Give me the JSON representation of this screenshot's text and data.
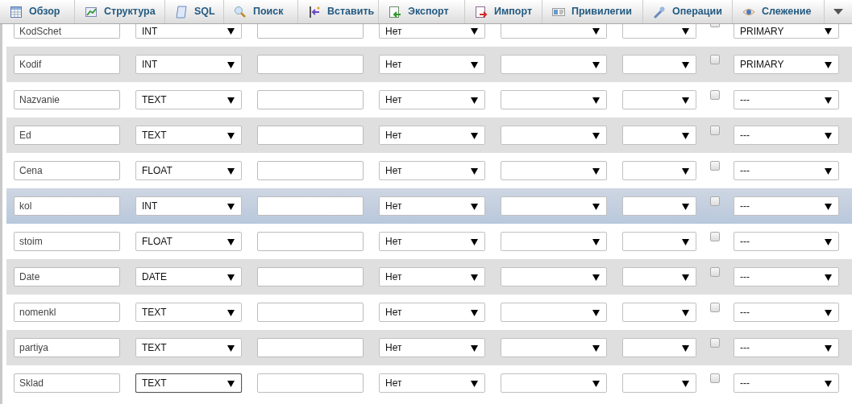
{
  "tabs": [
    {
      "label": "Обзор"
    },
    {
      "label": "Структура"
    },
    {
      "label": "SQL"
    },
    {
      "label": "Поиск"
    },
    {
      "label": "Вставить"
    },
    {
      "label": "Экспорт"
    },
    {
      "label": "Импорт"
    },
    {
      "label": "Привилегии"
    },
    {
      "label": "Операции"
    },
    {
      "label": "Слежение"
    }
  ],
  "rows": [
    {
      "name": "KodSchet",
      "type": "INT",
      "null": "Нет",
      "index": "PRIMARY",
      "checked": false,
      "highlighted": false,
      "focused": false
    },
    {
      "name": "Kodif",
      "type": "INT",
      "null": "Нет",
      "index": "PRIMARY",
      "checked": false,
      "highlighted": false,
      "focused": false
    },
    {
      "name": "Nazvanie",
      "type": "TEXT",
      "null": "Нет",
      "index": "---",
      "checked": false,
      "highlighted": false,
      "focused": false
    },
    {
      "name": "Ed",
      "type": "TEXT",
      "null": "Нет",
      "index": "---",
      "checked": false,
      "highlighted": false,
      "focused": false
    },
    {
      "name": "Cena",
      "type": "FLOAT",
      "null": "Нет",
      "index": "---",
      "checked": false,
      "highlighted": false,
      "focused": false
    },
    {
      "name": "kol",
      "type": "INT",
      "null": "Нет",
      "index": "---",
      "checked": false,
      "highlighted": true,
      "focused": false
    },
    {
      "name": "stoim",
      "type": "FLOAT",
      "null": "Нет",
      "index": "---",
      "checked": false,
      "highlighted": false,
      "focused": false
    },
    {
      "name": "Date",
      "type": "DATE",
      "null": "Нет",
      "index": "---",
      "checked": false,
      "highlighted": false,
      "focused": false
    },
    {
      "name": "nomenkl",
      "type": "TEXT",
      "null": "Нет",
      "index": "---",
      "checked": false,
      "highlighted": false,
      "focused": false
    },
    {
      "name": "partiya",
      "type": "TEXT",
      "null": "Нет",
      "index": "---",
      "checked": false,
      "highlighted": false,
      "focused": false
    },
    {
      "name": "Sklad",
      "type": "TEXT",
      "null": "Нет",
      "index": "---",
      "checked": false,
      "highlighted": false,
      "focused": true
    }
  ]
}
